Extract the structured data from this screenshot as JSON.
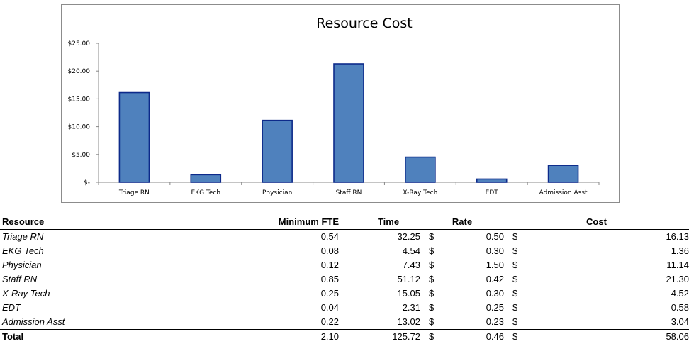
{
  "chart_data": {
    "type": "bar",
    "title": "Resource Cost",
    "categories": [
      "Triage RN",
      "EKG Tech",
      "Physician",
      "Staff RN",
      "X-Ray Tech",
      "EDT",
      "Admission Asst"
    ],
    "values": [
      16.13,
      1.36,
      11.14,
      21.3,
      4.52,
      0.58,
      3.04
    ],
    "ylim": [
      0,
      25
    ],
    "yticks": [
      0,
      5,
      10,
      15,
      20,
      25
    ],
    "ytick_labels": [
      "$-",
      "$5.00",
      "$10.00",
      "$15.00",
      "$20.00",
      "$25.00"
    ],
    "grid": false,
    "legend": "none",
    "bar_color": "#4f81bd",
    "bar_border_color": "#0d2a8a"
  },
  "table": {
    "headers": {
      "resource": "Resource",
      "fte": "Minimum FTE",
      "time": "Time",
      "rate": "Rate",
      "cost": "Cost"
    },
    "currency_symbol": "$",
    "rows": [
      {
        "resource": "Triage RN",
        "fte": "0.54",
        "time": "32.25",
        "rate": "0.50",
        "cost": "16.13"
      },
      {
        "resource": "EKG Tech",
        "fte": "0.08",
        "time": "4.54",
        "rate": "0.30",
        "cost": "1.36"
      },
      {
        "resource": "Physician",
        "fte": "0.12",
        "time": "7.43",
        "rate": "1.50",
        "cost": "11.14"
      },
      {
        "resource": "Staff RN",
        "fte": "0.85",
        "time": "51.12",
        "rate": "0.42",
        "cost": "21.30"
      },
      {
        "resource": "X-Ray Tech",
        "fte": "0.25",
        "time": "15.05",
        "rate": "0.30",
        "cost": "4.52"
      },
      {
        "resource": "EDT",
        "fte": "0.04",
        "time": "2.31",
        "rate": "0.25",
        "cost": "0.58"
      },
      {
        "resource": "Admission Asst",
        "fte": "0.22",
        "time": "13.02",
        "rate": "0.23",
        "cost": "3.04"
      }
    ],
    "total": {
      "resource": "Total",
      "fte": "2.10",
      "time": "125.72",
      "rate": "0.46",
      "cost": "58.06"
    }
  }
}
